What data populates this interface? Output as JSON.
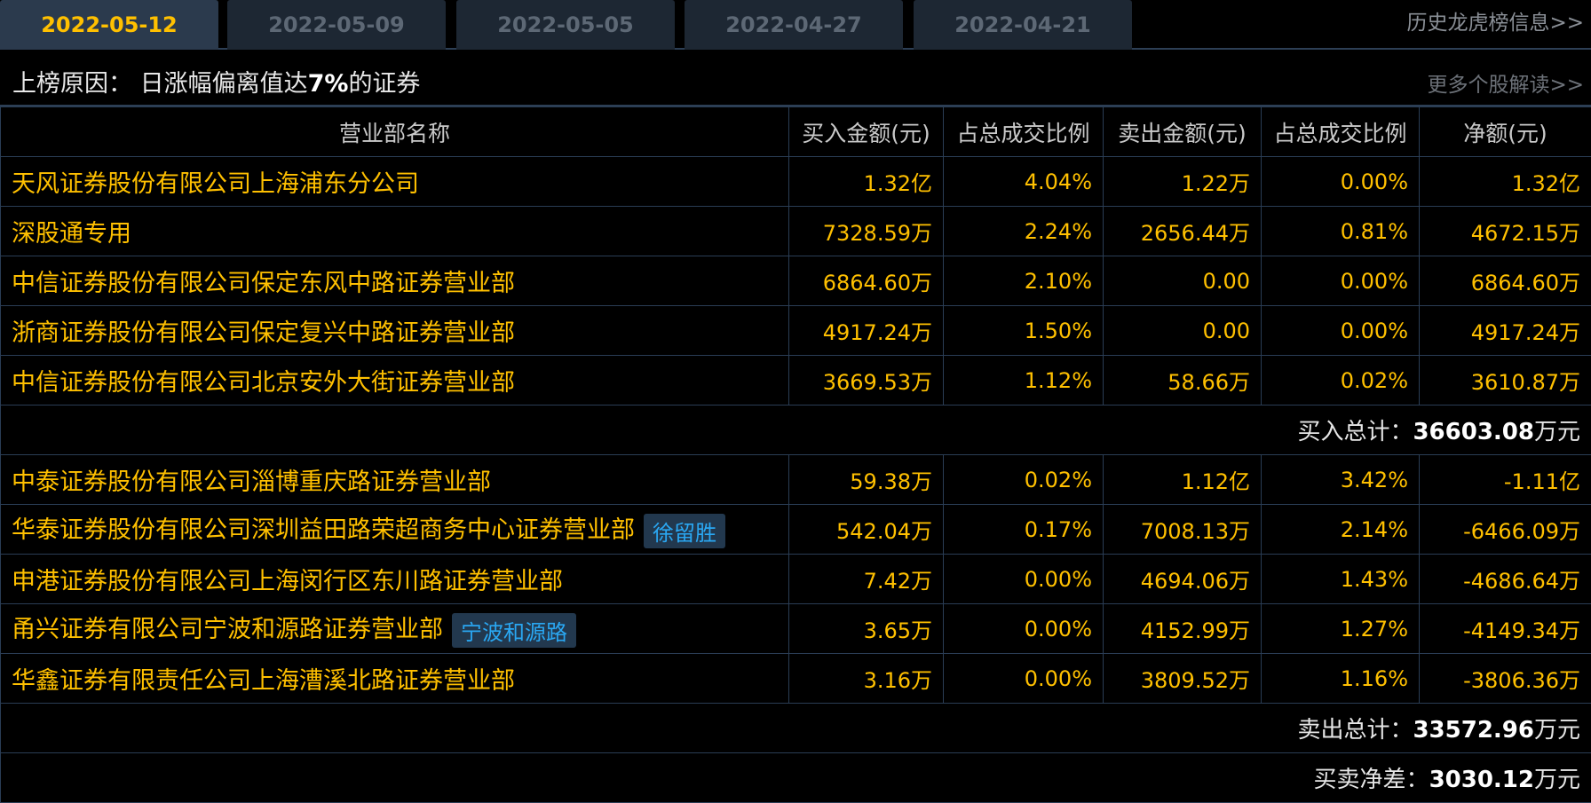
{
  "tabs": [
    {
      "label": "2022-05-12",
      "active": true
    },
    {
      "label": "2022-05-09",
      "active": false
    },
    {
      "label": "2022-05-05",
      "active": false
    },
    {
      "label": "2022-04-27",
      "active": false
    },
    {
      "label": "2022-04-21",
      "active": false
    }
  ],
  "history_link": "历史龙虎榜信息>>",
  "reason": {
    "prefix": "上榜原因：  日涨幅偏离值达",
    "highlight": "7%",
    "suffix": "的证券"
  },
  "more_link": "更多个股解读>>",
  "columns": [
    "营业部名称",
    "买入金额(元)",
    "占总成交比例",
    "卖出金额(元)",
    "占总成交比例",
    "净额(元)"
  ],
  "buy_rows": [
    {
      "name": "天风证券股份有限公司上海浦东分公司",
      "tag": "",
      "buy": "1.32亿",
      "buy_pct": "4.04%",
      "sell": "1.22万",
      "sell_pct": "0.00%",
      "net": "1.32亿"
    },
    {
      "name": "深股通专用",
      "tag": "",
      "buy": "7328.59万",
      "buy_pct": "2.24%",
      "sell": "2656.44万",
      "sell_pct": "0.81%",
      "net": "4672.15万"
    },
    {
      "name": "中信证券股份有限公司保定东风中路证券营业部",
      "tag": "",
      "buy": "6864.60万",
      "buy_pct": "2.10%",
      "sell": "0.00",
      "sell_pct": "0.00%",
      "net": "6864.60万"
    },
    {
      "name": "浙商证券股份有限公司保定复兴中路证券营业部",
      "tag": "",
      "buy": "4917.24万",
      "buy_pct": "1.50%",
      "sell": "0.00",
      "sell_pct": "0.00%",
      "net": "4917.24万"
    },
    {
      "name": "中信证券股份有限公司北京安外大街证券营业部",
      "tag": "",
      "buy": "3669.53万",
      "buy_pct": "1.12%",
      "sell": "58.66万",
      "sell_pct": "0.02%",
      "net": "3610.87万"
    }
  ],
  "buy_total": {
    "label": "买入总计：",
    "value": "36603.08",
    "unit": "万元"
  },
  "sell_rows": [
    {
      "name": "中泰证券股份有限公司淄博重庆路证券营业部",
      "tag": "",
      "buy": "59.38万",
      "buy_pct": "0.02%",
      "sell": "1.12亿",
      "sell_pct": "3.42%",
      "net": "-1.11亿"
    },
    {
      "name": "华泰证券股份有限公司深圳益田路荣超商务中心证券营业部",
      "tag": "徐留胜",
      "buy": "542.04万",
      "buy_pct": "0.17%",
      "sell": "7008.13万",
      "sell_pct": "2.14%",
      "net": "-6466.09万"
    },
    {
      "name": "申港证券股份有限公司上海闵行区东川路证券营业部",
      "tag": "",
      "buy": "7.42万",
      "buy_pct": "0.00%",
      "sell": "4694.06万",
      "sell_pct": "1.43%",
      "net": "-4686.64万"
    },
    {
      "name": "甬兴证券有限公司宁波和源路证券营业部",
      "tag": "宁波和源路",
      "buy": "3.65万",
      "buy_pct": "0.00%",
      "sell": "4152.99万",
      "sell_pct": "1.27%",
      "net": "-4149.34万"
    },
    {
      "name": "华鑫证券有限责任公司上海漕溪北路证券营业部",
      "tag": "",
      "buy": "3.16万",
      "buy_pct": "0.00%",
      "sell": "3809.52万",
      "sell_pct": "1.16%",
      "net": "-3806.36万"
    }
  ],
  "sell_total": {
    "label": "卖出总计：",
    "value": "33572.96",
    "unit": "万元"
  },
  "net_diff": {
    "label": "买卖净差：",
    "value": "3030.12",
    "unit": "万元"
  },
  "colors": {
    "accent": "#ffc000",
    "tag": "#2aa7f2",
    "border": "#2a3d55"
  }
}
